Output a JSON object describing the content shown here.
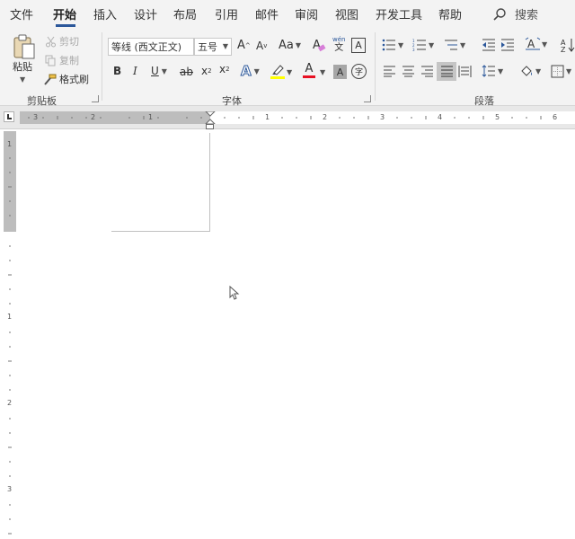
{
  "tabs": [
    "文件",
    "开始",
    "插入",
    "设计",
    "布局",
    "引用",
    "邮件",
    "审阅",
    "视图",
    "开发工具",
    "帮助"
  ],
  "active_tab": "开始",
  "search": {
    "label": "搜索",
    "icon": "search-icon"
  },
  "clipboard": {
    "group_label": "剪贴板",
    "paste": "粘贴",
    "cut": "剪切",
    "copy": "复制",
    "format_painter": "格式刷"
  },
  "font": {
    "group_label": "字体",
    "font_name": "等线 (西文正文)",
    "font_size": "五号",
    "grow": "A",
    "shrink": "A",
    "change_case": "Aa",
    "phonetic_top": "wén",
    "phonetic_bottom": "文",
    "border_char": "A",
    "bold": "B",
    "italic": "I",
    "underline": "U",
    "strikethrough": "ab",
    "subscript": "x",
    "superscript": "x",
    "text_effect": "A",
    "font_color": "A",
    "char_shading": "A",
    "enclose_char": "字",
    "highlight_color": "#ffff00",
    "font_color_value": "#e81123"
  },
  "paragraph": {
    "group_label": "段落"
  },
  "ruler": {
    "h_numbers": [
      "3",
      "2",
      "1",
      "1",
      "2",
      "3",
      "4",
      "5",
      "6"
    ],
    "v_numbers": [
      "1",
      "1",
      "2",
      "3"
    ]
  },
  "colors": {
    "accent": "#2b579a",
    "ribbon_bg": "#f3f3f3",
    "ruler_margin": "#bdbdbd"
  }
}
